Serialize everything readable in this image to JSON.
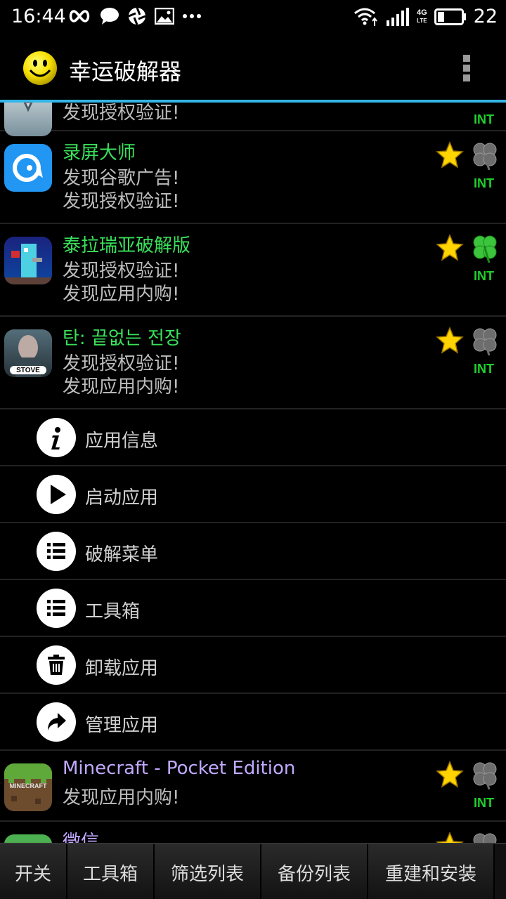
{
  "status_bar": {
    "time": "16:44",
    "left_icons": [
      "infinity-icon",
      "chat-bubble-icon",
      "aperture-icon",
      "image-icon",
      "more-dots-icon"
    ],
    "right_icons": [
      "wifi-icon",
      "signal-icon",
      "4g-lte-icon",
      "battery-icon"
    ],
    "network_type_top": "4G",
    "network_type_bottom": "LTE",
    "battery_level": "22"
  },
  "app_bar": {
    "title": "幸运破解器",
    "logo_icon": "smiley-face-icon",
    "overflow_icon": "overflow-menu-icon"
  },
  "apps_above": [
    {
      "name": "",
      "lines": [
        "发现授权验证!"
      ],
      "badge": "INT",
      "partial": true
    },
    {
      "name": "录屏大师",
      "lines": [
        "发现谷歌广告!",
        "发现授权验证!"
      ],
      "star": true,
      "clover_green": false,
      "badge": "INT",
      "icon": "screen-recorder-icon"
    },
    {
      "name": "泰拉瑞亚破解版",
      "lines": [
        "发现授权验证!",
        "发现应用内购!"
      ],
      "star": true,
      "clover_green": true,
      "badge": "INT",
      "icon": "terraria-icon"
    },
    {
      "name": "탄: 끝없는 전장",
      "lines": [
        "发现授权验证!",
        "发现应用内购!"
      ],
      "star": true,
      "clover_green": false,
      "badge": "INT",
      "icon": "stove-game-icon",
      "icon_text": "STOVE"
    }
  ],
  "context_menu": [
    {
      "label": "应用信息",
      "icon": "info-icon"
    },
    {
      "label": "启动应用",
      "icon": "play-icon"
    },
    {
      "label": "破解菜单",
      "icon": "list-icon"
    },
    {
      "label": "工具箱",
      "icon": "list-icon"
    },
    {
      "label": "卸载应用",
      "icon": "trash-icon"
    },
    {
      "label": "管理应用",
      "icon": "share-arrow-icon"
    }
  ],
  "apps_below": [
    {
      "name": "Minecraft - Pocket Edition",
      "lines": [
        "发现应用内购!"
      ],
      "star": true,
      "clover_green": false,
      "badge": "INT",
      "icon": "minecraft-icon",
      "icon_text": "MINECRAFT"
    },
    {
      "name": "微信",
      "lines": [],
      "star": true,
      "clover_green": false,
      "partial": true,
      "icon": "wechat-icon"
    }
  ],
  "tabs": [
    "开关",
    "工具箱",
    "筛选列表",
    "备份列表",
    "重建和安装"
  ],
  "colors": {
    "accent_line": "#33b5e5",
    "app_name_green": "#39e15b",
    "app_name_purple": "#c1a9ff",
    "badge_green": "#1fd12c",
    "star_yellow": "#ffd400"
  }
}
